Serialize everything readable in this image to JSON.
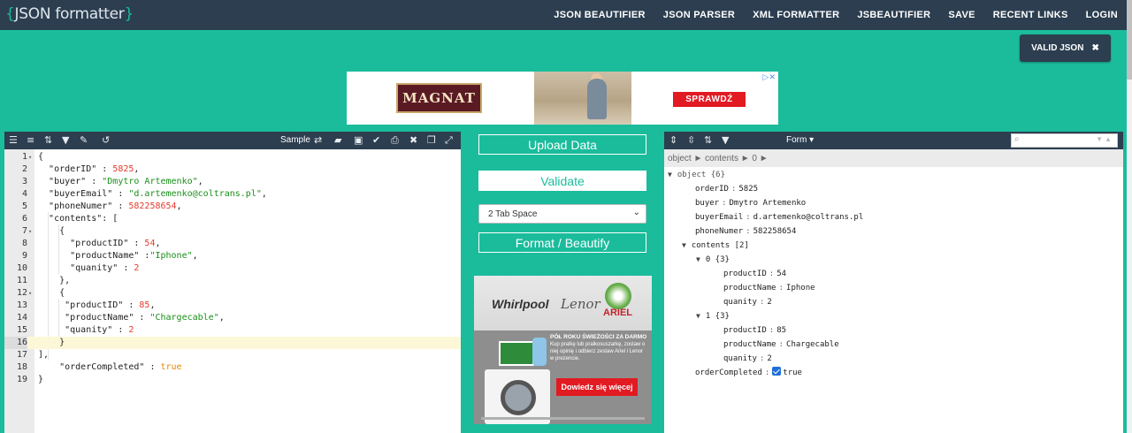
{
  "app": {
    "logo_open": "{",
    "logo_text": "JSON formatter",
    "logo_close": "}"
  },
  "nav": {
    "items": [
      "JSON BEAUTIFIER",
      "JSON PARSER",
      "XML FORMATTER",
      "JSBEAUTIFIER",
      "SAVE",
      "RECENT LINKS",
      "LOGIN"
    ]
  },
  "status": {
    "badge_label": "VALID JSON",
    "close_glyph": "✖"
  },
  "ads": {
    "top": {
      "brand": "MAGNAT",
      "cta": "SPRAWDŹ",
      "choice": "▷✕"
    },
    "side": {
      "brand1": "Whirlpool",
      "brand2": "Lenor",
      "brand3": "ARIEL",
      "headline": "PÓŁ ROKU ŚWIEŻOŚCI ZA DARMO",
      "body": "Kup pralkę lub pralkosuszarkę, zostaw o niej opinię i odbierz zestaw Ariel i Lenor w prezencie.",
      "cta": "Dowiedz się więcej"
    }
  },
  "left_editor": {
    "toolbar": {
      "sample_label": "Sample"
    },
    "lines": [
      "{",
      "  \"orderID\" : 5825,",
      "  \"buyer\" : \"Dmytro Artemenko\",",
      "  \"buyerEmail\" : \"d.artemenko@coltrans.pl\",",
      "  \"phoneNumer\" : 582258654,",
      "  \"contents\": [",
      "    {",
      "      \"productID\" : 54,",
      "      \"productName\" :\"Iphone\",",
      "      \"quanity\" : 2",
      "    },",
      "    {",
      "     \"productID\" : 85,",
      "     \"productName\" : \"Chargecable\",",
      "     \"quanity\" : 2",
      "    }",
      "],",
      "    \"orderCompleted\" : true",
      "}"
    ],
    "active_line": 16
  },
  "middle": {
    "upload_label": "Upload Data",
    "validate_label": "Validate",
    "tab_select_value": "2 Tab Space",
    "format_label": "Format / Beautify"
  },
  "right_tree": {
    "mode_label": "Form ▾",
    "breadcrumb": "object ► contents ► 0 ►",
    "root": "object {6}",
    "orderID": "5825",
    "buyer": "Dmytro Artemenko",
    "buyerEmail": "d.artemenko@coltrans.pl",
    "phoneNumer": "582258654",
    "contents_label": "contents [2]",
    "item0_label": "0 {3}",
    "item0_productID": "54",
    "item0_productName": "Iphone",
    "item0_quanity": "2",
    "item1_label": "1 {3}",
    "item1_productID": "85",
    "item1_productName": "Chargecable",
    "item1_quanity": "2",
    "orderCompleted": "true",
    "keys": {
      "orderID": "orderID",
      "buyer": "buyer",
      "buyerEmail": "buyerEmail",
      "phoneNumer": "phoneNumer",
      "productID": "productID",
      "productName": "productName",
      "quanity": "quanity",
      "orderCompleted": "orderCompleted"
    }
  },
  "colors": {
    "teal": "#1abc9c",
    "navy": "#2c3e50",
    "string_green": "#1a8f1a",
    "number_red": "#e63b2e",
    "bool_orange": "#e68a00"
  }
}
